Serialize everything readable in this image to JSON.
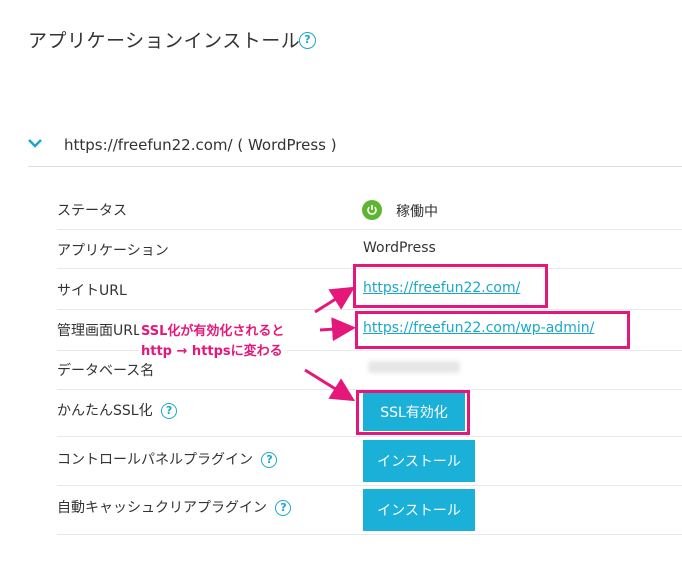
{
  "page": {
    "title": "アプリケーションインストール",
    "help_glyph": "?"
  },
  "section": {
    "title": "https://freefun22.com/ ( WordPress )"
  },
  "rows": {
    "status": {
      "label": "ステータス",
      "value": "稼働中"
    },
    "application": {
      "label": "アプリケーション",
      "value": "WordPress"
    },
    "site_url": {
      "label": "サイトURL",
      "value": "https://freefun22.com/"
    },
    "admin_url": {
      "label": "管理画面URL",
      "value": "https://freefun22.com/wp-admin/"
    },
    "database": {
      "label": "データベース名"
    },
    "ssl": {
      "label": "かんたんSSL化",
      "button": "SSL有効化"
    },
    "cp_plugin": {
      "label": "コントロールパネルプラグイン",
      "button": "インストール"
    },
    "cache_plugin": {
      "label": "自動キャッシュクリアプラグイン",
      "button": "インストール"
    }
  },
  "annotation": {
    "line1": "SSL化が有効化されると",
    "line2": "http → httpsに変わる"
  },
  "colors": {
    "accent": "#1aa8c8",
    "button": "#1ab0d8",
    "highlight": "#e6177a",
    "status_ok": "#5eb532"
  }
}
